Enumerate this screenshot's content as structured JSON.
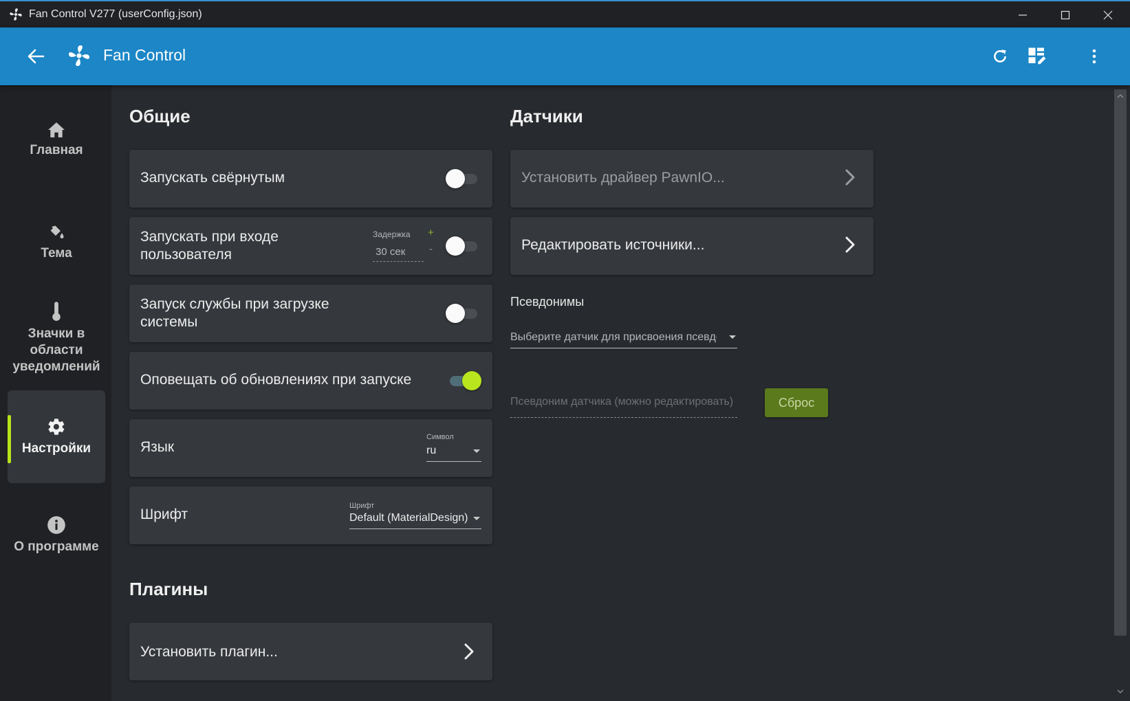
{
  "window": {
    "title": "Fan Control V277 (userConfig.json)"
  },
  "header": {
    "app_title": "Fan Control"
  },
  "sidebar": {
    "items": [
      {
        "label": "Главная",
        "icon": "home-icon"
      },
      {
        "label": "Тема",
        "icon": "paint-bucket-icon"
      },
      {
        "label": "Значки в области уведомлений",
        "icon": "thermometer-icon"
      },
      {
        "label": "Настройки",
        "icon": "gear-icon",
        "active": true
      },
      {
        "label": "О программе",
        "icon": "info-icon"
      }
    ]
  },
  "general": {
    "title": "Общие",
    "start_minimized": {
      "label": "Запускать свёрнутым",
      "enabled": false
    },
    "start_on_login": {
      "label": "Запускать при входе пользователя",
      "delay_label": "Задержка",
      "delay_value": "30 сек",
      "plus": "+",
      "minus": "-",
      "enabled": false
    },
    "start_service": {
      "label": "Запуск службы при загрузке системы",
      "enabled": false
    },
    "notify_updates": {
      "label": "Оповещать об обновлениях при запуске",
      "enabled": true
    },
    "language": {
      "label": "Язык",
      "field_label": "Символ",
      "value": "ru"
    },
    "font": {
      "label": "Шрифт",
      "field_label": "Шрифт",
      "value": "Default (MaterialDesign)"
    }
  },
  "plugins": {
    "title": "Плагины",
    "install_label": "Установить плагин..."
  },
  "sensors": {
    "title": "Датчики",
    "install_driver_label": "Установить драйвер PawnIO...",
    "edit_sources_label": "Редактировать источники...",
    "aliases_title": "Псевдонимы",
    "select_sensor_placeholder": "Выберите датчик для присвоения псевдс",
    "alias_placeholder": "Псевдоним датчика (можно редактировать)",
    "reset_label": "Сброс"
  },
  "colors": {
    "header": "#1c86c6",
    "accent": "#b8e51d",
    "reset_button": "#5a7a1c"
  }
}
